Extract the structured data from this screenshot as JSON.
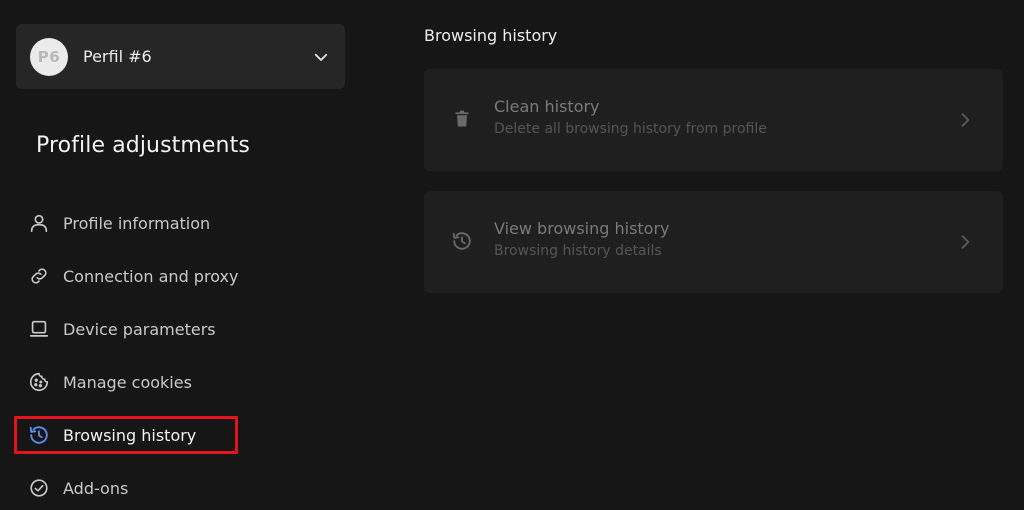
{
  "profile_selector": {
    "avatar_initials": "P6",
    "name": "Perfil #6"
  },
  "sidebar": {
    "title": "Profile adjustments",
    "items": [
      {
        "label": "Profile information",
        "icon": "user-icon"
      },
      {
        "label": "Connection and proxy",
        "icon": "link-icon"
      },
      {
        "label": "Device parameters",
        "icon": "laptop-icon"
      },
      {
        "label": "Manage cookies",
        "icon": "cookie-icon"
      },
      {
        "label": "Browsing history",
        "icon": "history-icon",
        "active": true
      },
      {
        "label": "Add-ons",
        "icon": "check-circle-icon"
      }
    ]
  },
  "main": {
    "title": "Browsing history",
    "cards": [
      {
        "title": "Clean history",
        "subtitle": "Delete all browsing history from profile",
        "icon": "trash-icon"
      },
      {
        "title": "View browsing history",
        "subtitle": "Browsing history details",
        "icon": "history-icon"
      }
    ]
  },
  "colors": {
    "background": "#161616",
    "panel": "#262626",
    "card": "#1f1f1f",
    "accent": "#5b8def",
    "highlight": "#e5131b"
  }
}
